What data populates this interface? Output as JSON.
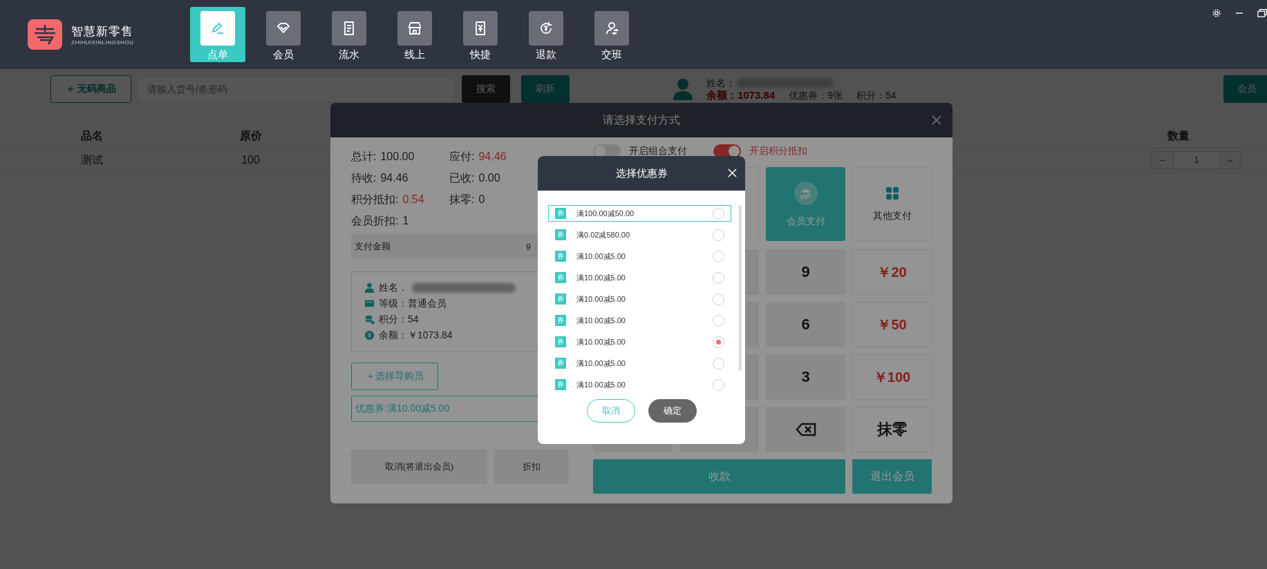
{
  "app": {
    "logo_title": "智慧新零售",
    "logo_subtitle": "ZHIHUIXINLINGSHOU"
  },
  "nav": [
    {
      "label": "点单",
      "kind": "edit",
      "selected": true
    },
    {
      "label": "会员",
      "kind": "diamond",
      "selected": false
    },
    {
      "label": "流水",
      "kind": "receipt",
      "selected": false
    },
    {
      "label": "线上",
      "kind": "store",
      "selected": false
    },
    {
      "label": "快捷",
      "kind": "yen-doc",
      "selected": false
    },
    {
      "label": "退款",
      "kind": "refund",
      "selected": false
    },
    {
      "label": "交班",
      "kind": "shift",
      "selected": false
    }
  ],
  "toolbar": {
    "no_code_button": "＋ 无码商品",
    "search_placeholder": "请输入货号/条形码",
    "search_button": "搜索",
    "refresh_button": "刷新"
  },
  "member_summary": {
    "name_label": "姓名：",
    "balance": "余额：1073.84",
    "coupons": "优惠券：9张",
    "points": "积分：54",
    "exit_button": "会员"
  },
  "table": {
    "columns": [
      "品名",
      "原价",
      "数量"
    ],
    "rows": [
      {
        "name": "测试",
        "price": "100",
        "decrement": "−",
        "quantity": "1",
        "increment": "+"
      }
    ]
  },
  "payment_dialog": {
    "title": "请选择支付方式",
    "summary": [
      {
        "label": "总计:",
        "value": "100.00",
        "emphasis": false
      },
      {
        "label": "应付:",
        "value": "94.46",
        "emphasis": true
      },
      {
        "label": "待收:",
        "value": "94.46",
        "emphasis": false
      },
      {
        "label": "已收:",
        "value": "0.00",
        "emphasis": false
      },
      {
        "label": "积分抵扣:",
        "value": "0.54",
        "emphasis": true
      },
      {
        "label": "抹零:",
        "value": "0",
        "emphasis": false
      },
      {
        "label": "会员折扣:",
        "value": "1",
        "emphasis": false
      }
    ],
    "pay_amount_label": "支付金额",
    "pay_amount_value": "9",
    "member_card": [
      {
        "kind": "name",
        "text": "姓名．"
      },
      {
        "kind": "level",
        "text": "等级：普通会员"
      },
      {
        "kind": "points",
        "text": "积分：54"
      },
      {
        "kind": "balance",
        "text": "余额：￥1073.84"
      }
    ],
    "guide_button": "＋选择导购员",
    "coupon_field": "优惠券:满10.00减5.00",
    "cancel_button": "取消(将退出会员)",
    "discount_button": "折扣",
    "toggles": [
      {
        "label": "开启组合支付",
        "on": false
      },
      {
        "label": "开启积分抵扣",
        "on": true
      }
    ],
    "methods": [
      {
        "label": "会员支付",
        "kind": "vip",
        "selected": true
      },
      {
        "label": "其他支付",
        "kind": "other",
        "selected": false
      }
    ],
    "keys": [
      {
        "kind": "digit",
        "label": "9"
      },
      {
        "kind": "amount",
        "label": "￥20"
      },
      {
        "kind": "digit",
        "label": "6"
      },
      {
        "kind": "amount",
        "label": "￥50"
      },
      {
        "kind": "digit",
        "label": "3"
      },
      {
        "kind": "amount",
        "label": "￥100"
      },
      {
        "kind": "backspace"
      },
      {
        "kind": "digit",
        "label": "抹零"
      }
    ],
    "collect_button": "收款",
    "exit_member_button": "退出会员"
  },
  "coupon_dialog": {
    "title": "选择优惠券",
    "coupons": [
      {
        "tag": "券",
        "label": "满100.00减50.00",
        "highlighted": true,
        "selected": false
      },
      {
        "tag": "券",
        "label": "满0.02减580.00",
        "highlighted": false,
        "selected": false
      },
      {
        "tag": "券",
        "label": "满10.00减5.00",
        "highlighted": false,
        "selected": false
      },
      {
        "tag": "券",
        "label": "满10.00减5.00",
        "highlighted": false,
        "selected": false
      },
      {
        "tag": "券",
        "label": "满10.00减5.00",
        "highlighted": false,
        "selected": false
      },
      {
        "tag": "券",
        "label": "满10.00减5.00",
        "highlighted": false,
        "selected": false
      },
      {
        "tag": "券",
        "label": "满10.00减5.00",
        "highlighted": false,
        "selected": true
      },
      {
        "tag": "券",
        "label": "满10.00减5.00",
        "highlighted": false,
        "selected": false
      },
      {
        "tag": "券",
        "label": "满10.00减5.00",
        "highlighted": false,
        "selected": false
      }
    ],
    "cancel": "取消",
    "confirm": "确定"
  }
}
